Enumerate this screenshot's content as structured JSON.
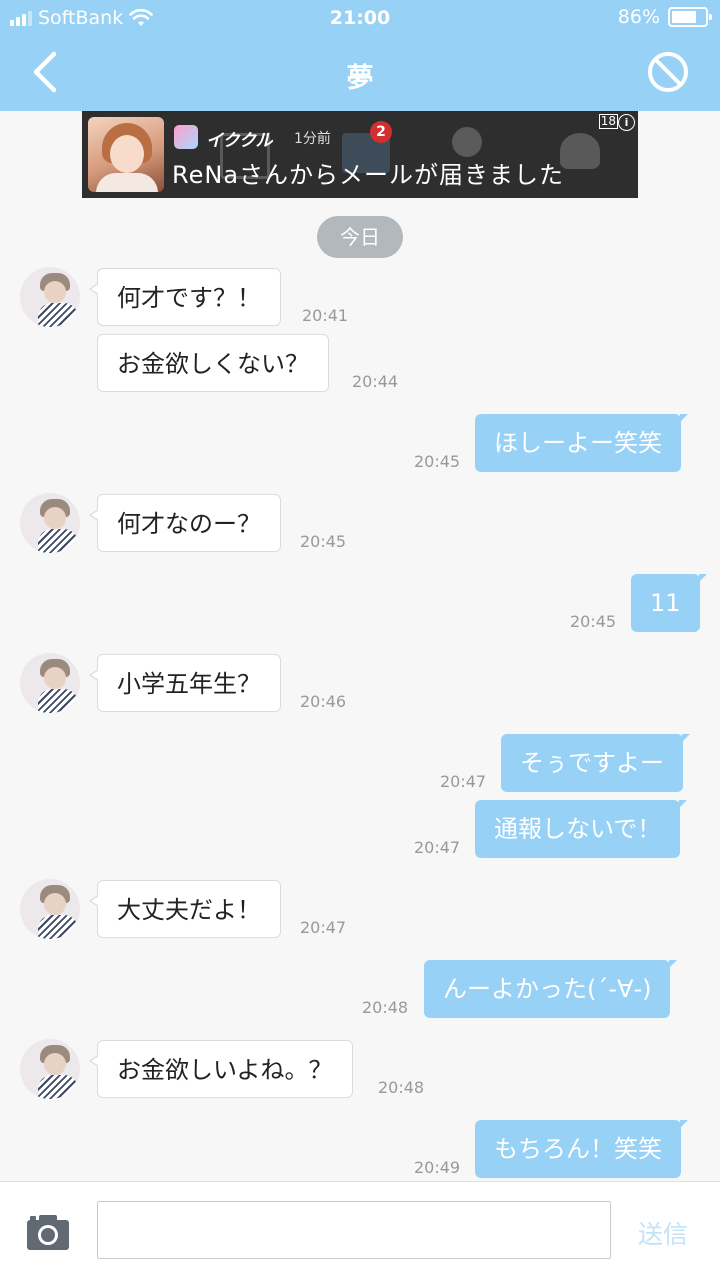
{
  "status_bar": {
    "carrier": "SoftBank",
    "time": "21:00",
    "battery": "86%",
    "battery_level": 0.86
  },
  "header": {
    "title": "夢",
    "back_icon": "chevron-left-icon",
    "block_icon": "block-icon"
  },
  "ad_banner": {
    "app_name": "イククル",
    "time_ago": "1分前",
    "badge": "2",
    "message": "ReNaさんからメールが届きました",
    "age_mark": "18",
    "info_icon": "i"
  },
  "date_label": "今日",
  "messages": [
    {
      "dir": "in",
      "text": "何才です？！",
      "time": "20:41"
    },
    {
      "dir": "in",
      "text": "お金欲しくない？",
      "time": "20:44"
    },
    {
      "dir": "out",
      "text": "ほしーよー笑笑",
      "time": "20:45"
    },
    {
      "dir": "in",
      "text": "何才なのー？",
      "time": "20:45"
    },
    {
      "dir": "out",
      "text": "11",
      "time": "20:45"
    },
    {
      "dir": "in",
      "text": "小学五年生？",
      "time": "20:46"
    },
    {
      "dir": "out",
      "text": "そぅですよー",
      "time": "20:47"
    },
    {
      "dir": "out",
      "text": "通報しないで！",
      "time": "20:47"
    },
    {
      "dir": "in",
      "text": "大丈夫だよ！",
      "time": "20:47"
    },
    {
      "dir": "out",
      "text": "んーよかった(´-∀-)",
      "time": "20:48"
    },
    {
      "dir": "in",
      "text": "お金欲しいよね。？",
      "time": "20:48"
    },
    {
      "dir": "out",
      "text": "もちろん！笑笑",
      "time": "20:49"
    }
  ],
  "composer": {
    "value": "",
    "send_label": "送信",
    "camera_icon": "camera-icon"
  },
  "colors": {
    "accent": "#97d1f6",
    "background": "#f7f7f7",
    "send_disabled": "#c3e3f7"
  }
}
